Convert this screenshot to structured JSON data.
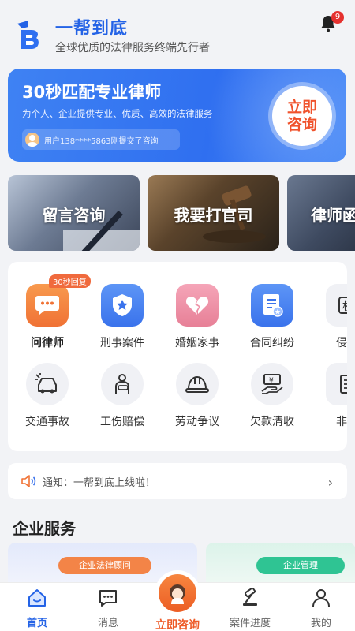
{
  "header": {
    "app_name": "一帮到底",
    "slogan": "全球优质的法律服务终端先行者",
    "notification_count": "9"
  },
  "banner": {
    "title": "30秒匹配专业律师",
    "subtitle": "为个人、企业提供专业、优质、高效的法律服务",
    "user_notice": "用户138****5863刚提交了咨询",
    "consult_button": "立即咨询"
  },
  "service_cards": [
    {
      "label": "留言咨询"
    },
    {
      "label": "我要打官司"
    },
    {
      "label": "律师函"
    }
  ],
  "categories": {
    "row1": [
      {
        "label": "问律师",
        "icon": "chat-bubble-icon",
        "tag": "30秒回复"
      },
      {
        "label": "刑事案件",
        "icon": "shield-star-icon"
      },
      {
        "label": "婚姻家事",
        "icon": "broken-heart-icon"
      },
      {
        "label": "合同纠纷",
        "icon": "contract-icon"
      },
      {
        "label": "侵权",
        "icon": "infringement-icon"
      }
    ],
    "row2": [
      {
        "label": "交通事故",
        "icon": "car-accident-icon"
      },
      {
        "label": "工伤赔偿",
        "icon": "injury-icon"
      },
      {
        "label": "劳动争议",
        "icon": "helmet-icon"
      },
      {
        "label": "欠款清收",
        "icon": "debt-icon"
      },
      {
        "label": "非讼",
        "icon": "non-litigation-icon"
      }
    ]
  },
  "notice": {
    "label": "通知：",
    "text": "一帮到底上线啦！"
  },
  "enterprise": {
    "title": "企业服务",
    "cards": [
      {
        "tag": "企业法律顾问"
      },
      {
        "tag": "企业管理"
      }
    ]
  },
  "tabbar": {
    "tabs": [
      {
        "label": "首页",
        "icon": "home-icon"
      },
      {
        "label": "消息",
        "icon": "message-icon"
      },
      {
        "label": "立即咨询",
        "icon": "lawyer-avatar-icon"
      },
      {
        "label": "案件进度",
        "icon": "gavel-icon"
      },
      {
        "label": "我的",
        "icon": "profile-icon"
      }
    ],
    "active": "首页"
  },
  "colors": {
    "brand_blue": "#2463e6",
    "accent_orange": "#ee5b28",
    "badge_red": "#e5312f"
  }
}
